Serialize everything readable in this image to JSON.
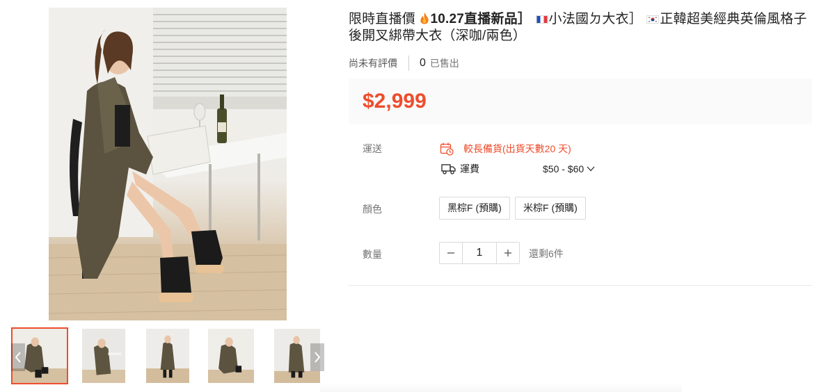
{
  "product": {
    "title": {
      "part1": "限時直播價",
      "part2": "10.27直播新品］",
      "part3": "小法國ㄉ大衣］",
      "part4": "正韓超美經典英倫風格子後開叉綁帶大衣（深咖/兩色）"
    },
    "title_icons": [
      "fire-emoji",
      "france-flag",
      "korea-flag"
    ],
    "rating_text": "尚未有評價",
    "sold_count": "0",
    "sold_label": "已售出",
    "price": "$2,999"
  },
  "shipping": {
    "label": "運送",
    "note": "較長備貨(出貨天數20 天)",
    "fee_label": "運費",
    "fee_value": "$50 - $60"
  },
  "color": {
    "label": "顏色",
    "options": [
      "黑棕F (預購)",
      "米棕F (預購)"
    ]
  },
  "quantity": {
    "label": "數量",
    "value": "1",
    "stock_text": "還剩6件"
  },
  "gallery": {
    "thumbnail_count": 5,
    "active_index": 0
  },
  "colors": {
    "accent": "#ee4d2d",
    "price_bg": "#fafafa",
    "muted_text": "#757575"
  }
}
